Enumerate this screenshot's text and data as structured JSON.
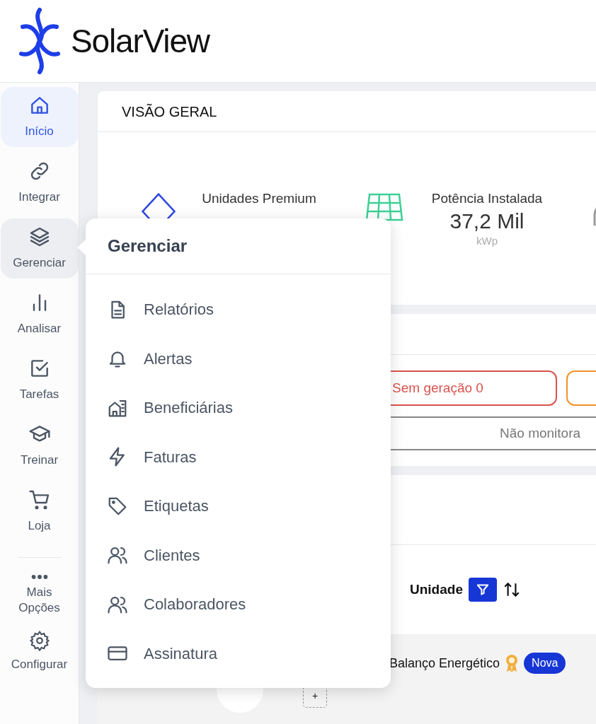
{
  "brand": {
    "name": "SolarView"
  },
  "sidebar": {
    "items": [
      {
        "kind": "home",
        "label": "Início",
        "selected": true,
        "expanded": false
      },
      {
        "kind": "link",
        "label": "Integrar",
        "selected": false,
        "expanded": false
      },
      {
        "kind": "layers",
        "label": "Gerenciar",
        "selected": false,
        "expanded": true
      },
      {
        "kind": "chart",
        "label": "Analisar",
        "selected": false,
        "expanded": false
      },
      {
        "kind": "task",
        "label": "Tarefas",
        "selected": false,
        "expanded": false
      },
      {
        "kind": "cap",
        "label": "Treinar",
        "selected": false,
        "expanded": false
      },
      {
        "kind": "cart",
        "label": "Loja",
        "selected": false,
        "expanded": false
      }
    ],
    "bottom_items": [
      {
        "kind": "dots",
        "label": "Mais Opções"
      },
      {
        "kind": "gear",
        "label": "Configurar"
      }
    ]
  },
  "overview": {
    "title": "VISÃO GERAL",
    "stats": [
      {
        "kind": "premium",
        "label": "Unidades Premium"
      },
      {
        "kind": "power",
        "label": "Potência Instalada",
        "value": "37,2 Mil",
        "unit": "kWp"
      }
    ]
  },
  "status": {
    "buttons": [
      {
        "label": "Sem geração 0",
        "color": "#d9534f"
      },
      {
        "color": "#f0922e"
      }
    ],
    "row_text": "Não monitora"
  },
  "table": {
    "column": "Unidade",
    "row_text": "Balanço Energético",
    "badge": "Nova",
    "add": "+"
  },
  "popup": {
    "title": "Gerenciar",
    "items": [
      {
        "kind": "doc",
        "label": "Relatórios"
      },
      {
        "kind": "bell",
        "label": "Alertas"
      },
      {
        "kind": "building",
        "label": "Beneficiárias"
      },
      {
        "kind": "bolt",
        "label": "Faturas"
      },
      {
        "kind": "tag",
        "label": "Etiquetas"
      },
      {
        "kind": "users",
        "label": "Clientes"
      },
      {
        "kind": "users",
        "label": "Colaboradores"
      },
      {
        "kind": "card",
        "label": "Assinatura"
      }
    ]
  }
}
